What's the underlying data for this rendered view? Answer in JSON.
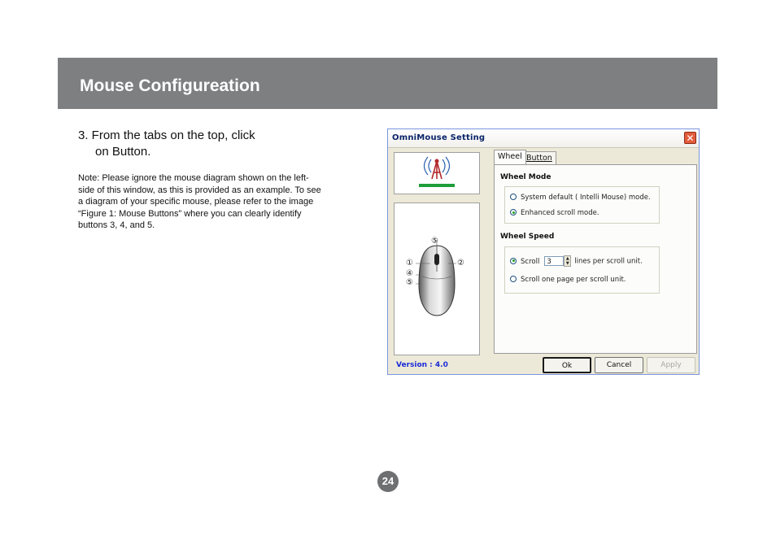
{
  "header": {
    "title": "Mouse Configureation"
  },
  "instructions": {
    "step_line1": "3.  From the tabs on the top, click",
    "step_line2": "on Button.",
    "note": "Note:  Please ignore the mouse diagram shown on the left-side of this window, as this is provided as an example.  To see a diagram of your specific mouse, please refer to the image “Figure 1: Mouse Buttons” where you can clearly identify buttons 3, 4, and 5."
  },
  "dialog": {
    "title": "OmniMouse Setting",
    "close_glyph": "✕",
    "tabs": [
      {
        "label": "Wheel",
        "selected": true
      },
      {
        "label": "Button",
        "selected": false
      }
    ],
    "wheel_mode": {
      "title": "Wheel Mode",
      "options": [
        {
          "label": "System default ( Intelli Mouse) mode.",
          "selected": false
        },
        {
          "label": "Enhanced scroll mode.",
          "selected": true
        }
      ]
    },
    "wheel_speed": {
      "title": "Wheel Speed",
      "scroll_label": "Scroll",
      "scroll_value": "3",
      "scroll_suffix": "lines per scroll unit.",
      "page_label": "Scroll one page per scroll unit.",
      "scroll_selected": true
    },
    "mouse_callouts": [
      "⑤",
      "①",
      "②",
      "④",
      "⑤"
    ],
    "version": "Version : 4.0",
    "buttons": {
      "ok": "Ok",
      "cancel": "Cancel",
      "apply": "Apply"
    }
  },
  "page_number": "24",
  "colors": {
    "header_bar": "#7d7f81",
    "version_text": "#1a2bd8",
    "accent_green": "#1e9e3a"
  }
}
